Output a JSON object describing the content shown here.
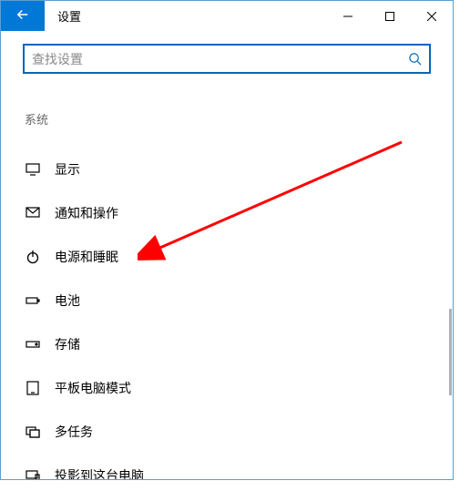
{
  "titlebar": {
    "title": "设置"
  },
  "search": {
    "placeholder": "查找设置"
  },
  "section": {
    "header": "系统"
  },
  "nav": {
    "items": [
      {
        "label": "显示"
      },
      {
        "label": "通知和操作"
      },
      {
        "label": "电源和睡眠"
      },
      {
        "label": "电池"
      },
      {
        "label": "存储"
      },
      {
        "label": "平板电脑模式"
      },
      {
        "label": "多任务"
      },
      {
        "label": "投影到这台电脑"
      }
    ]
  }
}
